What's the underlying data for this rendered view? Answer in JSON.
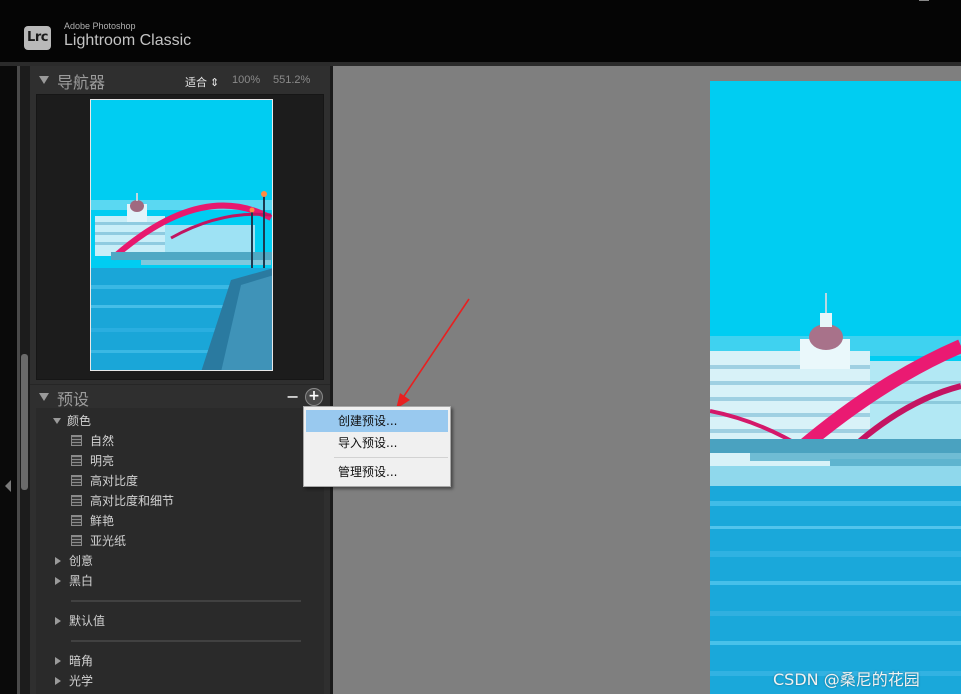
{
  "app": {
    "logo_text": "Lrc",
    "brand_top": "Adobe Photoshop",
    "brand_main": "Lightroom Classic"
  },
  "navigator": {
    "title": "导航器",
    "zoom_options": [
      "适合 ⇕",
      "100%",
      "551.2%"
    ]
  },
  "presets": {
    "title": "预设",
    "minus_label": "−",
    "plus_label": "+",
    "groups": {
      "color": {
        "label": "颜色",
        "items": [
          "自然",
          "明亮",
          "高对比度",
          "高对比度和细节",
          "鲜艳",
          "亚光纸"
        ]
      },
      "creative": "创意",
      "bw": "黑白",
      "defaults": "默认值",
      "vignette": "暗角",
      "optics": "光学"
    }
  },
  "context_menu": {
    "items": [
      "创建预设...",
      "导入预设...",
      "管理预设..."
    ],
    "active_index": 0
  },
  "colors": {
    "sky": "#00c8f0",
    "bridge": "#e8186e",
    "water": "#1aa6d8",
    "menu_highlight": "#99c9ef",
    "arrow": "#e82020"
  },
  "watermark": "CSDN @桑尼的花园"
}
